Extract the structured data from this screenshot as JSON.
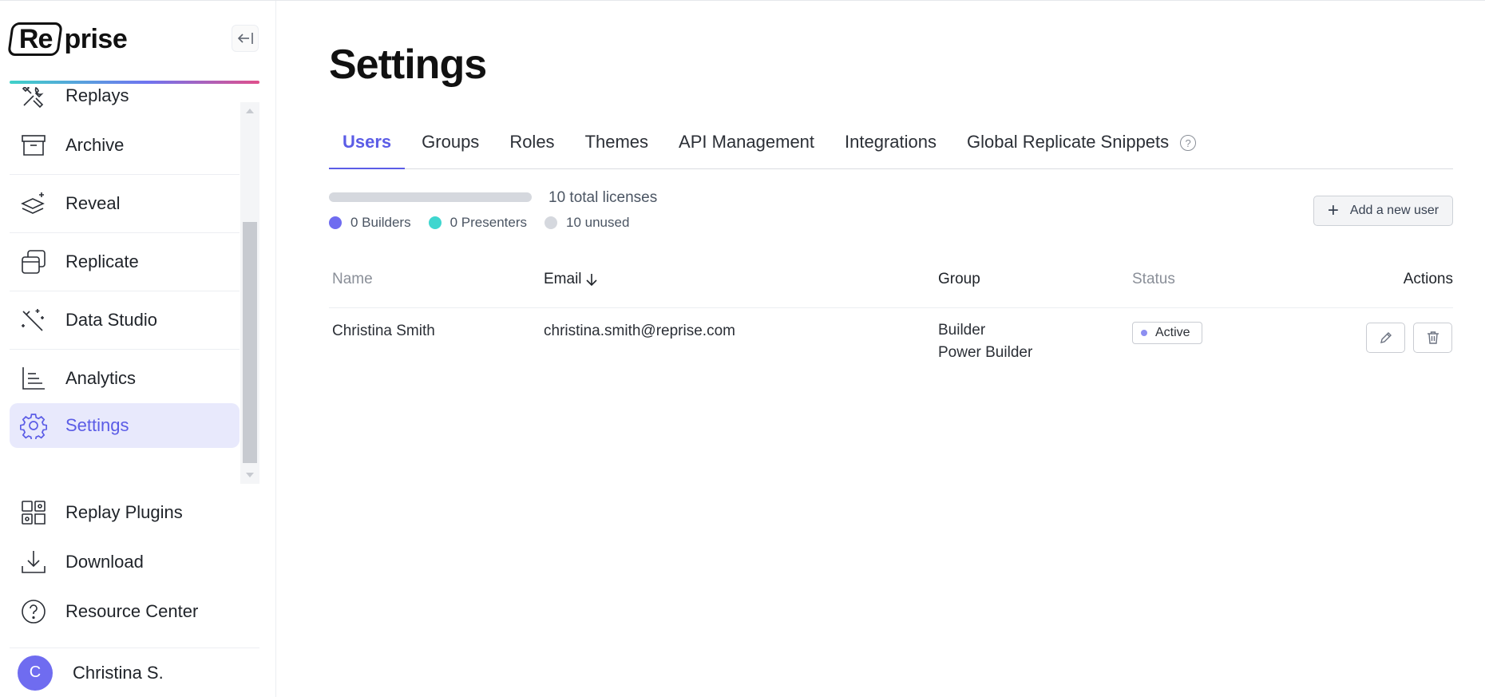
{
  "app": {
    "logo_boxed": "Re",
    "logo_rest": "prise"
  },
  "sidebar": {
    "items": [
      {
        "label": "Replays",
        "icon": "tools-icon"
      },
      {
        "label": "Archive",
        "icon": "archive-icon"
      },
      {
        "label": "Reveal",
        "icon": "layers-sparkle-icon"
      },
      {
        "label": "Replicate",
        "icon": "windows-icon"
      },
      {
        "label": "Data Studio",
        "icon": "magic-wand-icon"
      },
      {
        "label": "Analytics",
        "icon": "bar-chart-icon"
      },
      {
        "label": "Settings",
        "icon": "gear-icon",
        "active": true
      }
    ],
    "bottom_items": [
      {
        "label": "Replay Plugins",
        "icon": "puzzle-icon"
      },
      {
        "label": "Download",
        "icon": "download-icon"
      },
      {
        "label": "Resource Center",
        "icon": "help-circle-icon"
      }
    ],
    "user": {
      "initial": "C",
      "name": "Christina S."
    }
  },
  "page": {
    "title": "Settings",
    "tabs": [
      "Users",
      "Groups",
      "Roles",
      "Themes",
      "API Management",
      "Integrations",
      "Global Replicate Snippets"
    ],
    "active_tab": "Users"
  },
  "licenses": {
    "total_label": "10 total licenses",
    "legend": [
      {
        "label": "0 Builders",
        "color": "#6f6cf0"
      },
      {
        "label": "0 Presenters",
        "color": "#3fd6cf"
      },
      {
        "label": "10 unused",
        "color": "#d5d8de"
      }
    ]
  },
  "actions": {
    "add_user_label": "Add a new user"
  },
  "table": {
    "headers": {
      "name": "Name",
      "email": "Email",
      "group": "Group",
      "status": "Status",
      "actions": "Actions"
    },
    "rows": [
      {
        "name": "Christina Smith",
        "email": "christina.smith@reprise.com",
        "groups": [
          "Builder",
          "Power Builder"
        ],
        "status": "Active"
      }
    ]
  },
  "colors": {
    "accent": "#5b5ce6",
    "active_bg": "#e8e9fc"
  }
}
